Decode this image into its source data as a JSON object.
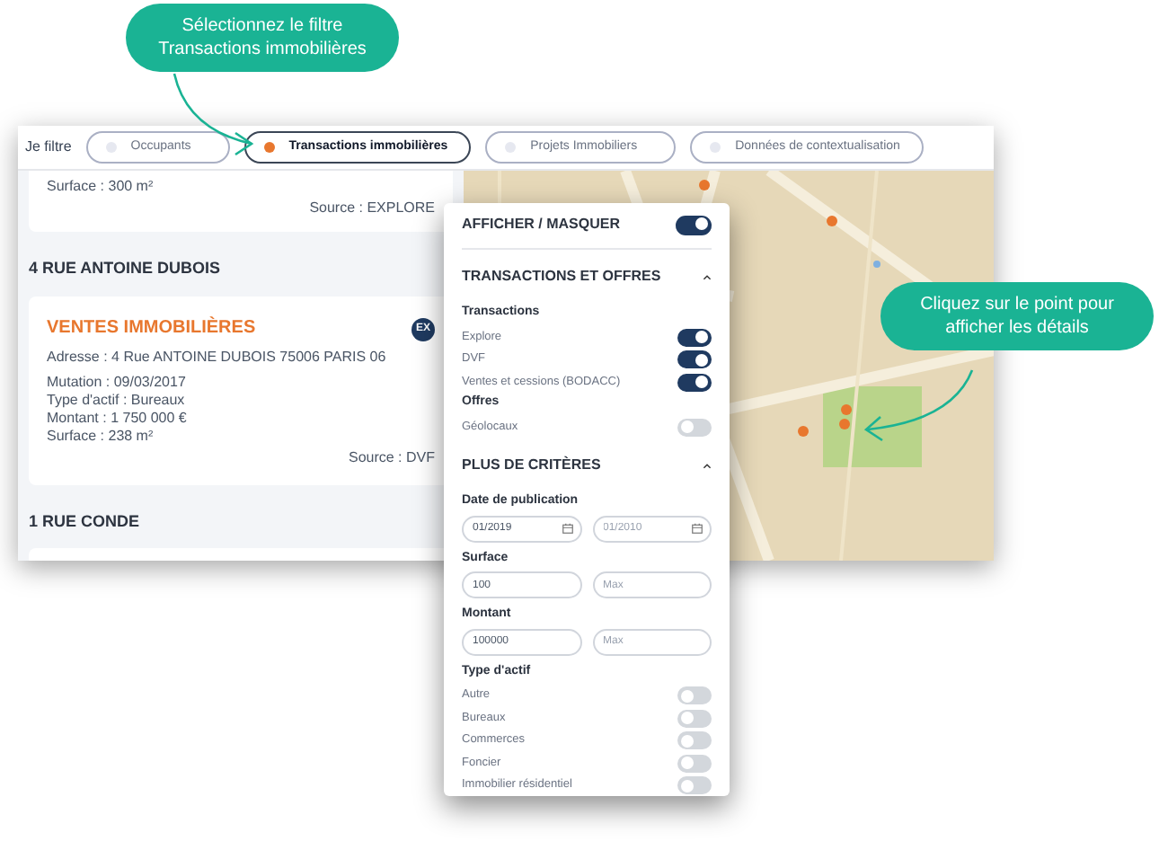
{
  "callouts": [
    {
      "kind": "top",
      "lines": [
        "Sélectionnez le filtre",
        "Transactions immobilières"
      ]
    },
    {
      "kind": "map",
      "lines": [
        "Cliquez sur le point pour",
        "afficher les détails"
      ]
    }
  ],
  "filter_bar": {
    "label": "Je filtre",
    "filters": [
      {
        "label": "Occupants",
        "selected": false
      },
      {
        "label": "Transactions immobilières",
        "selected": true
      },
      {
        "label": "Projets Immobiliers",
        "selected": false
      },
      {
        "label": "Données de contextualisation",
        "selected": false
      }
    ]
  },
  "results": [
    {
      "kind": "card",
      "lines": [
        "Surface : 300 m²"
      ],
      "source": "Source : EXPLORE"
    },
    {
      "kind": "heading",
      "text": "4 RUE ANTOINE DUBOIS"
    },
    {
      "kind": "card",
      "title": "VENTES IMMOBILIÈRES",
      "badge": "EX",
      "address": "Adresse : 4 Rue ANTOINE DUBOIS 75006 PARIS 06",
      "lines": [
        "Mutation : 09/03/2017",
        "Type d'actif : Bureaux",
        "Montant : 1 750 000 €",
        "Surface : 238 m²"
      ],
      "source": "Source : DVF"
    },
    {
      "kind": "heading",
      "text": "1 RUE CONDE"
    }
  ],
  "panel": [
    {
      "kind": "master",
      "label": "AFFICHER / MASQUER",
      "on": true
    },
    {
      "kind": "section",
      "label": "TRANSACTIONS ET OFFRES",
      "expanded": true
    },
    {
      "kind": "subheading",
      "label": "Transactions"
    },
    {
      "kind": "toggle",
      "label": "Explore",
      "on": true
    },
    {
      "kind": "toggle",
      "label": "DVF",
      "on": true
    },
    {
      "kind": "toggle",
      "label": "Ventes et cessions (BODACC)",
      "on": true
    },
    {
      "kind": "subheading",
      "label": "Offres"
    },
    {
      "kind": "toggle",
      "label": "Géolocaux",
      "on": false
    },
    {
      "kind": "section",
      "label": "PLUS DE CRITÈRES",
      "expanded": true
    },
    {
      "kind": "subheading",
      "label": "Date de publication"
    },
    {
      "kind": "fields",
      "inputs": [
        {
          "kind": "date",
          "value": "01/2019"
        },
        {
          "kind": "date",
          "placeholder": "01/2010"
        }
      ]
    },
    {
      "kind": "subheading",
      "label": "Surface"
    },
    {
      "kind": "fields",
      "inputs": [
        {
          "kind": "text",
          "value": "100"
        },
        {
          "kind": "text",
          "placeholder": "Max"
        }
      ]
    },
    {
      "kind": "subheading",
      "label": "Montant"
    },
    {
      "kind": "fields",
      "inputs": [
        {
          "kind": "text",
          "value": "100000"
        },
        {
          "kind": "text",
          "placeholder": "Max"
        }
      ]
    },
    {
      "kind": "subheading",
      "label": "Type d'actif"
    },
    {
      "kind": "toggle",
      "label": "Autre",
      "on": false
    },
    {
      "kind": "toggle",
      "label": "Bureaux",
      "on": false
    },
    {
      "kind": "toggle",
      "label": "Commerces",
      "on": false
    },
    {
      "kind": "toggle",
      "label": "Foncier",
      "on": false
    },
    {
      "kind": "toggle",
      "label": "Immobilier résidentiel",
      "on": false
    }
  ]
}
